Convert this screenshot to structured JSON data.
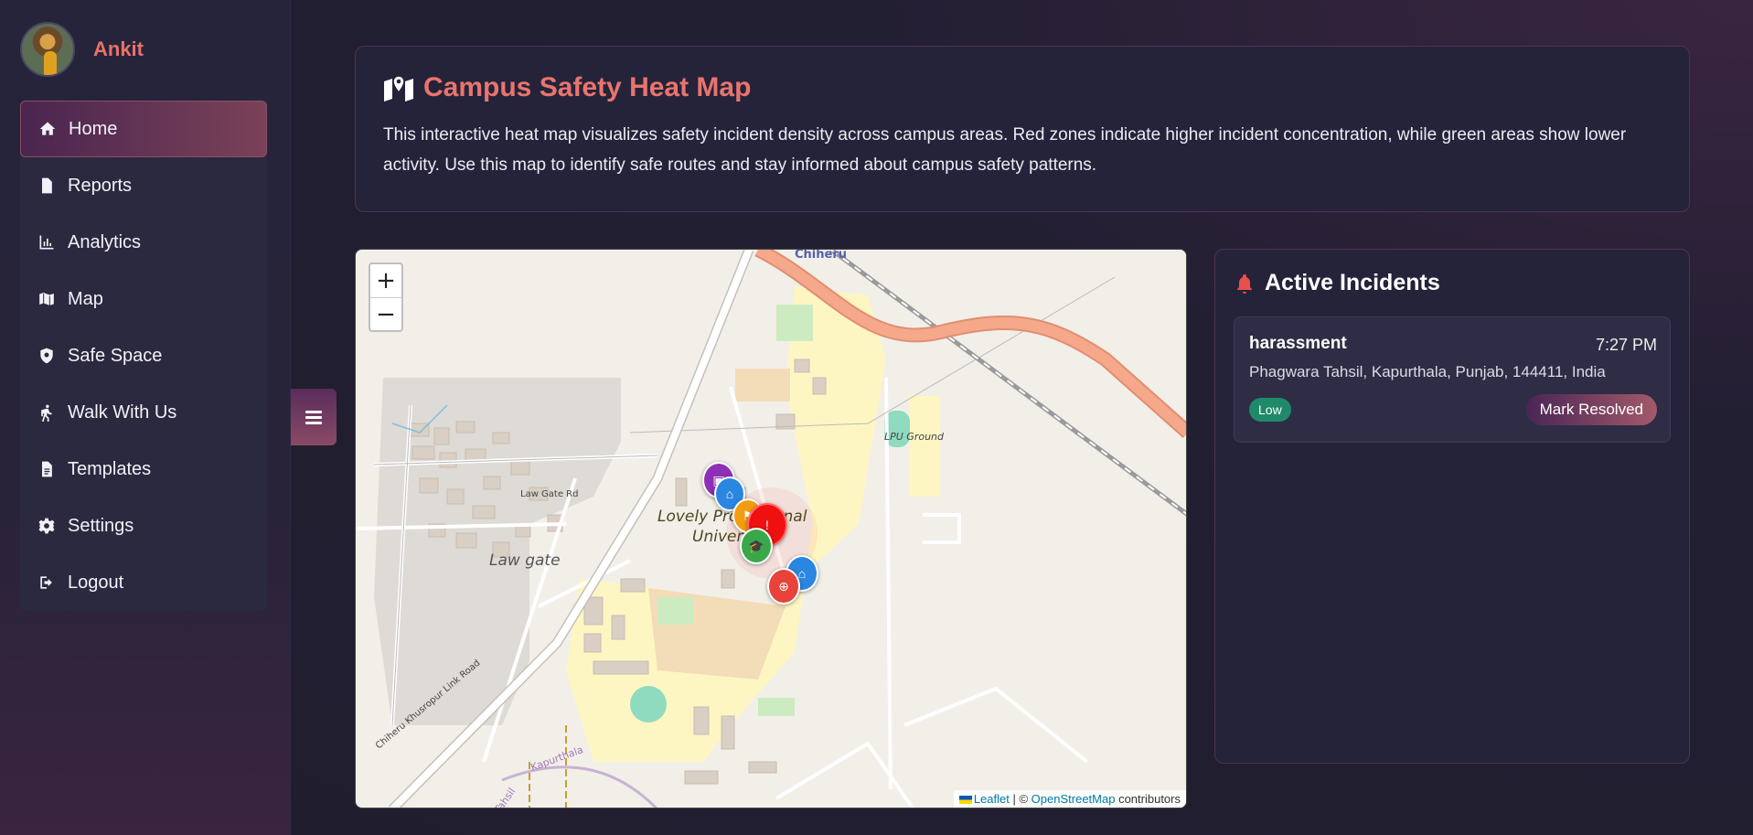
{
  "user": {
    "name": "Ankit"
  },
  "nav": [
    {
      "label": "Home",
      "icon": "home-icon",
      "active": true
    },
    {
      "label": "Reports",
      "icon": "file-icon"
    },
    {
      "label": "Analytics",
      "icon": "chart-icon"
    },
    {
      "label": "Map",
      "icon": "map-icon"
    },
    {
      "label": "Safe Space",
      "icon": "shield-icon"
    },
    {
      "label": "Walk With Us",
      "icon": "walking-icon"
    },
    {
      "label": "Templates",
      "icon": "document-icon"
    },
    {
      "label": "Settings",
      "icon": "gear-icon"
    },
    {
      "label": "Logout",
      "icon": "logout-icon"
    }
  ],
  "header": {
    "title": "Campus Safety Heat Map",
    "description": "This interactive heat map visualizes safety incident density across campus areas. Red zones indicate higher incident concentration, while green areas show lower activity. Use this map to identify safe routes and stay informed about campus safety patterns."
  },
  "map": {
    "zoom_in": "+",
    "zoom_out": "−",
    "labels": {
      "chiheru": "Chiheru",
      "lpu_ground": "LPU Ground",
      "law_gate_rd": "Law Gate Rd",
      "law_gate": "Law gate",
      "university_1": "Lovely Professional",
      "university_2": "University",
      "link_road": "Chiheru Khusropur Link Road",
      "kapurthala": "Kapurthala",
      "tahsil": "a Tahsil"
    },
    "attribution": {
      "leaflet": "Leaflet",
      "separator": " | © ",
      "osm": "OpenStreetMap",
      "suffix": " contributors"
    }
  },
  "incidents": {
    "title": "Active Incidents",
    "items": [
      {
        "type": "harassment",
        "time": "7:27 PM",
        "location": "Phagwara Tahsil, Kapurthala, Punjab, 144411, India",
        "severity": "Low",
        "action": "Mark Resolved"
      }
    ]
  },
  "colors": {
    "accent": "#e8756d",
    "severity_low": "#1f8a6a"
  }
}
